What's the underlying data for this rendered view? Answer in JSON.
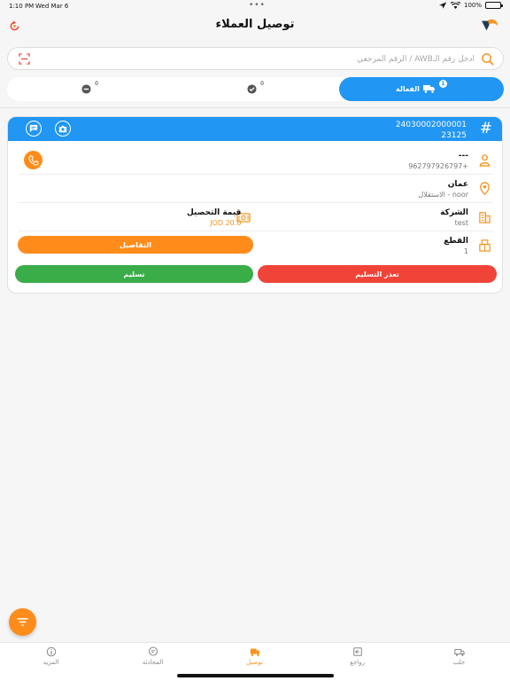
{
  "status_bar": {
    "time": "1:10 PM",
    "date": "Wed Mar 6",
    "battery": "100%"
  },
  "header": {
    "title": "توصيل العملاء"
  },
  "search": {
    "placeholder": "ادخل رقم الـAWB / الرقم المرجعي"
  },
  "tabs": [
    {
      "label": "الفعالة",
      "count": "1",
      "active": true
    },
    {
      "label": "",
      "count": "0",
      "active": false
    },
    {
      "label": "",
      "count": "0",
      "active": false
    }
  ],
  "shipment": {
    "awb": "24030002000001",
    "ref": "23125",
    "customer_name": "---",
    "phone": "962797926797+",
    "city": "عمان",
    "area": "الاستقلال - noor",
    "company_label": "الشركة",
    "company_value": "test",
    "cod_label": "قيمة التحصيل",
    "cod_value": "JOD 20.0",
    "pieces_label": "القطع",
    "pieces_value": "1"
  },
  "buttons": {
    "details": "التفاصيل",
    "deliver": "تسليم",
    "failed": "تعذر التسليم"
  },
  "nav": [
    {
      "label": "جلب",
      "icon": "pickup-icon"
    },
    {
      "label": "رواجع",
      "icon": "returns-icon"
    },
    {
      "label": "توصيل",
      "icon": "delivery-icon",
      "active": true
    },
    {
      "label": "المحادثة",
      "icon": "chat-icon"
    },
    {
      "label": "المزيد",
      "icon": "more-icon"
    }
  ],
  "colors": {
    "primary": "#2196f3",
    "accent": "#ff8c1a",
    "success": "#3aac48",
    "danger": "#f04438"
  }
}
